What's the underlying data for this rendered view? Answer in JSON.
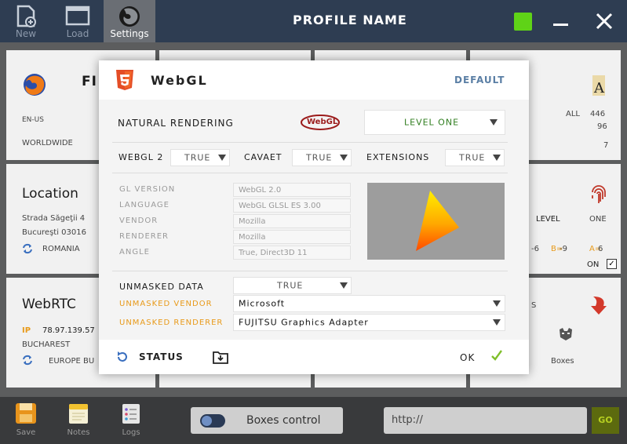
{
  "header": {
    "tools": [
      {
        "label": "New",
        "icon": "new-file-icon"
      },
      {
        "label": "Load",
        "icon": "window-icon"
      },
      {
        "label": "Settings",
        "icon": "firefox-icon"
      }
    ],
    "profile_name": "PROFILE NAME",
    "status_color": "#5fd317"
  },
  "background": {
    "browser_card": {
      "title": "FI",
      "locale": "EN-US",
      "region": "WORLDWIDE"
    },
    "fonts_card": {
      "all_label": "ALL",
      "count1": "446",
      "count2": "96",
      "count3": "7"
    },
    "location_card": {
      "title": "Location",
      "address1": "Strada Săgeţii 4",
      "address2": "Bucureşti 03016",
      "country": "ROMANIA"
    },
    "fingerprint_card": {
      "level_label": "LEVEL",
      "level_value": "ONE",
      "r_value": "-6",
      "b_label": "B=",
      "b_value": "-9",
      "a_label": "A=",
      "a_value": "6",
      "on_label": "ON"
    },
    "webrtc_card": {
      "title": "WebRTC",
      "ip_label": "IP",
      "ip_value": "78.97.139.57",
      "city": "BUCHAREST",
      "zone": "EUROPE BU"
    },
    "boxes_card": {
      "s_letter": "S",
      "label": "Boxes"
    }
  },
  "modal": {
    "title": "WebGL",
    "default_label": "DEFAULT",
    "natural_rendering": {
      "label": "NATURAL RENDERING",
      "logo_text": "WebGL",
      "value": "LEVEL ONE"
    },
    "webgl2": {
      "label": "WEBGL 2",
      "value": "TRUE"
    },
    "caveat": {
      "label": "CAVAET",
      "value": "TRUE"
    },
    "extensions": {
      "label": "EXTENSIONS",
      "value": "TRUE"
    },
    "info": [
      {
        "label": "GL VERSION",
        "value": "WebGL 2.0"
      },
      {
        "label": "LANGUAGE",
        "value": "WebGL GLSL ES 3.00"
      },
      {
        "label": "VENDOR",
        "value": "Mozilla"
      },
      {
        "label": "RENDERER",
        "value": "Mozilla"
      },
      {
        "label": "ANGLE",
        "value": "True, Direct3D 11"
      }
    ],
    "unmasked_data": {
      "label": "UNMASKED DATA",
      "value": "TRUE"
    },
    "unmasked_vendor": {
      "label": "UNMASKED VENDOR",
      "value": "Microsoft"
    },
    "unmasked_renderer": {
      "label": "UNMASKED RENDERER",
      "value": "FUJITSU Graphics Adapter"
    },
    "footer": {
      "status_label": "STATUS",
      "ok_label": "OK"
    },
    "accent": "#e89a1a",
    "ok_color": "#7fbf2a"
  },
  "bottom": {
    "tools": [
      {
        "label": "Save",
        "icon": "save-icon"
      },
      {
        "label": "Notes",
        "icon": "notes-icon"
      },
      {
        "label": "Logs",
        "icon": "logs-icon"
      }
    ],
    "boxes_control": "Boxes control",
    "url": "http://",
    "go_label": "GO"
  }
}
